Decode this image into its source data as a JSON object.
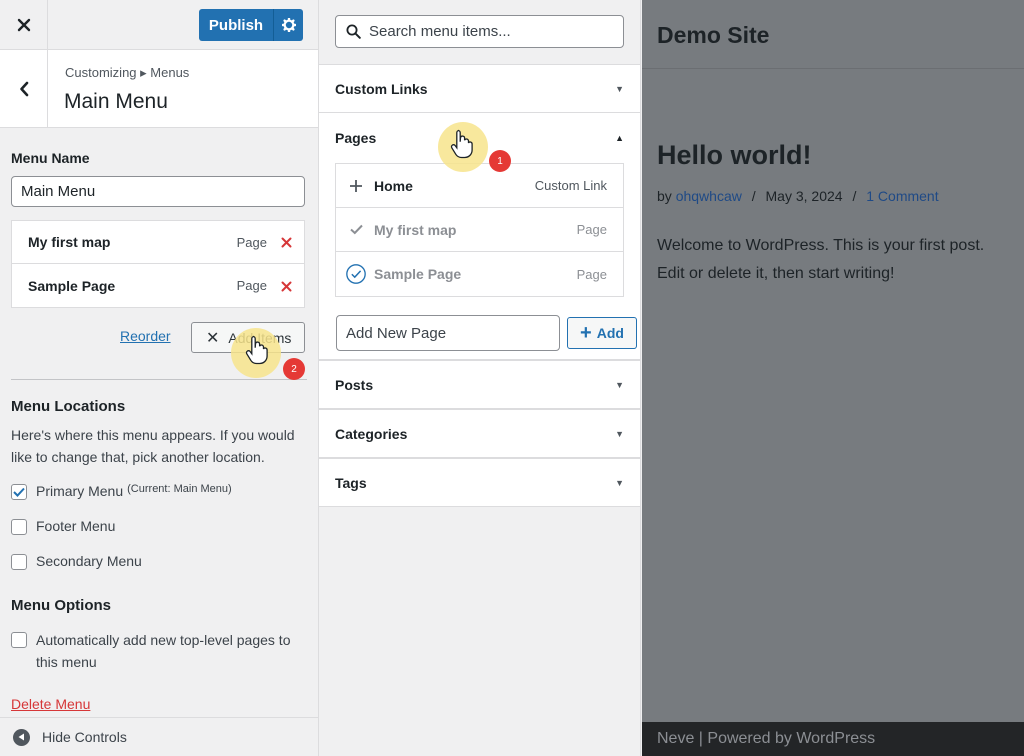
{
  "topbar": {
    "close_icon": "close-icon",
    "publish_label": "Publish",
    "settings_icon": "gear-icon"
  },
  "section": {
    "breadcrumb": "Customizing ▸ Menus",
    "title": "Main Menu"
  },
  "menu_name": {
    "label": "Menu Name",
    "value": "Main Menu"
  },
  "menu_items": [
    {
      "title": "My first map",
      "type": "Page"
    },
    {
      "title": "Sample Page",
      "type": "Page"
    }
  ],
  "actions": {
    "reorder_label": "Reorder",
    "add_items_label": "Add Items"
  },
  "locations": {
    "label": "Menu Locations",
    "description": "Here's where this menu appears. If you would like to change that, pick another location.",
    "options": [
      {
        "label": "Primary Menu",
        "note": "(Current: Main Menu)",
        "checked": true
      },
      {
        "label": "Footer Menu",
        "note": "",
        "checked": false
      },
      {
        "label": "Secondary Menu",
        "note": "",
        "checked": false
      }
    ]
  },
  "options": {
    "label": "Menu Options",
    "auto_add": "Automatically add new top-level pages to this menu",
    "auto_add_checked": false
  },
  "delete_label": "Delete Menu",
  "hide_controls_label": "Hide Controls",
  "available": {
    "search_placeholder": "Search menu items...",
    "sections": {
      "custom_links": "Custom Links",
      "pages": "Pages",
      "posts": "Posts",
      "categories": "Categories",
      "tags": "Tags"
    },
    "pages": [
      {
        "title": "Home",
        "type": "Custom Link",
        "state": "add"
      },
      {
        "title": "My first map",
        "type": "Page",
        "state": "added"
      },
      {
        "title": "Sample Page",
        "type": "Page",
        "state": "added-focus"
      }
    ],
    "new_page_placeholder": "Add New Page",
    "add_label": "Add"
  },
  "preview": {
    "site_title": "Demo Site",
    "post_title": "Hello world!",
    "meta": {
      "by": "by",
      "author": "ohqwhcaw",
      "sep": "/",
      "date": "May 3, 2024",
      "comments": "1 Comment"
    },
    "excerpt": "Welcome to WordPress. This is your first post. Edit or delete it, then start writing!",
    "footer": "Neve | Powered by WordPress"
  },
  "tutorial": {
    "step1": "1",
    "step2": "2"
  },
  "colors": {
    "accent": "#2271b1",
    "danger": "#d63638",
    "halo": "#f7e48c",
    "badge": "#e53935"
  }
}
